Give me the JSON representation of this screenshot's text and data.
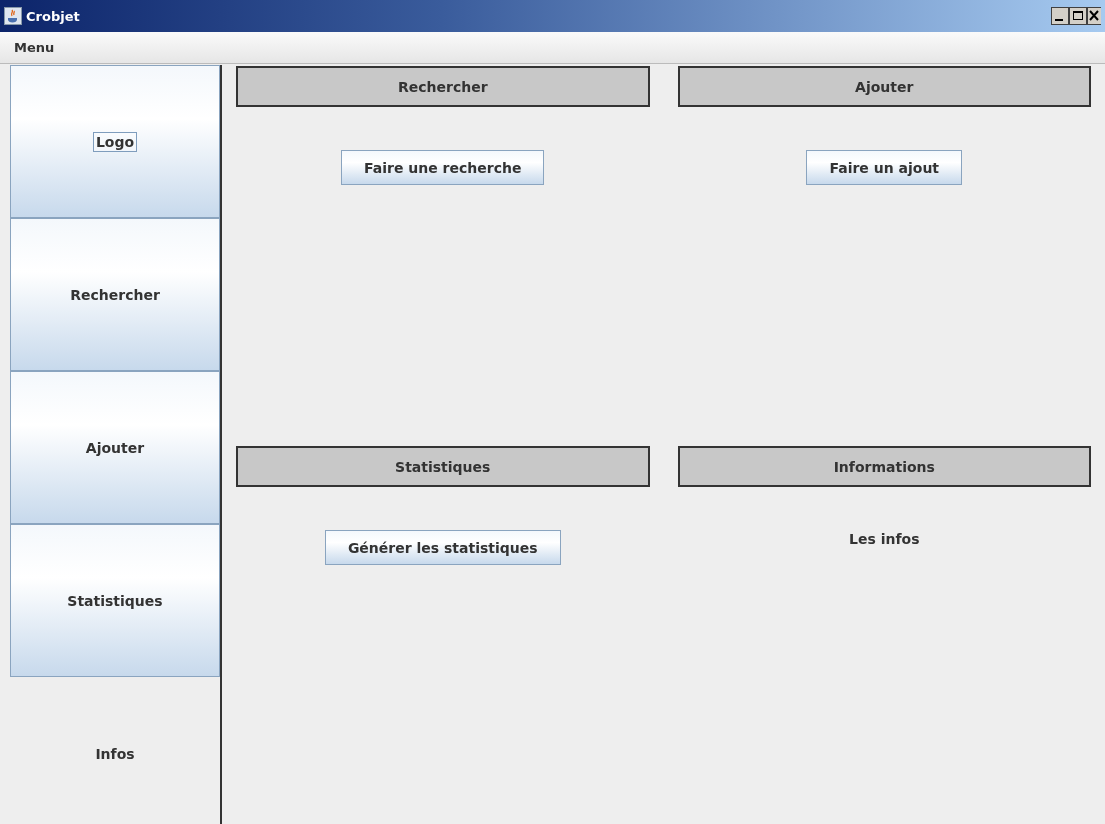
{
  "window": {
    "title": "Crobjet"
  },
  "menu_bar": [
    "Menu"
  ],
  "sidebar": {
    "items": [
      {
        "label": "Logo",
        "selected": false,
        "focused": true
      },
      {
        "label": "Rechercher",
        "selected": false,
        "focused": false
      },
      {
        "label": "Ajouter",
        "selected": false,
        "focused": false
      },
      {
        "label": "Statistiques",
        "selected": false,
        "focused": false
      },
      {
        "label": "Infos",
        "selected": true,
        "focused": false
      }
    ]
  },
  "panels": [
    {
      "header": "Rechercher",
      "kind": "button",
      "content": "Faire une recherche"
    },
    {
      "header": "Ajouter",
      "kind": "button",
      "content": "Faire un ajout"
    },
    {
      "header": "Statistiques",
      "kind": "button",
      "content": "Générer les statistiques"
    },
    {
      "header": "Informations",
      "kind": "text",
      "content": "Les infos"
    }
  ]
}
